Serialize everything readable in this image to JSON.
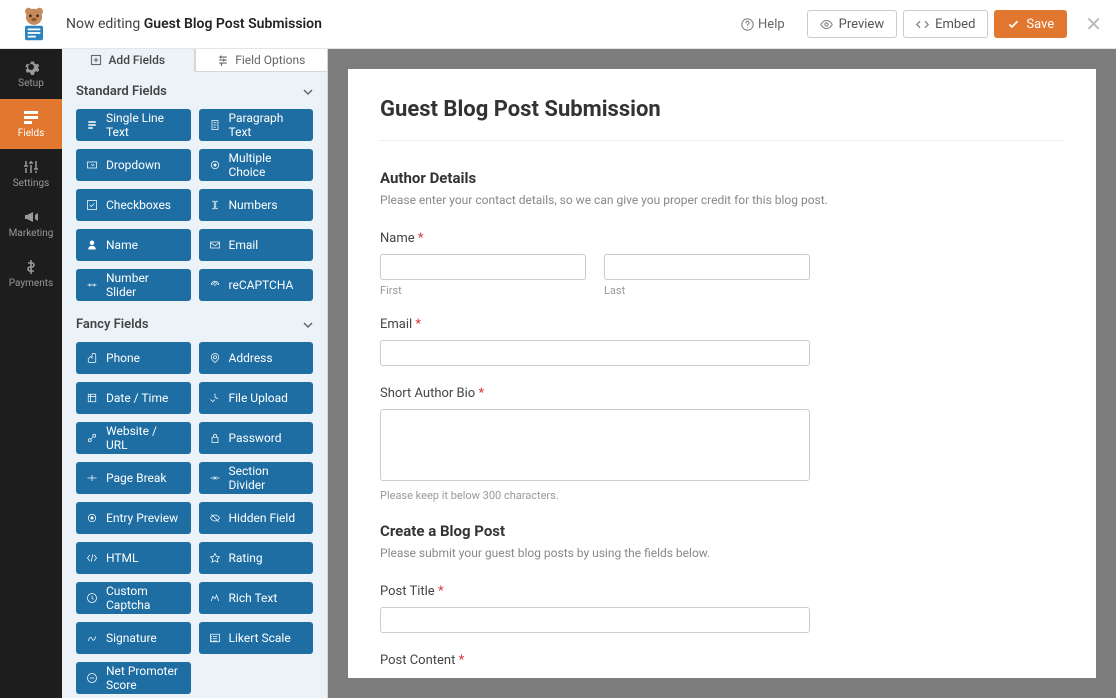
{
  "header": {
    "now_editing_prefix": "Now editing",
    "form_name": "Guest Blog Post Submission",
    "help": "Help",
    "preview": "Preview",
    "embed": "Embed",
    "save": "Save"
  },
  "leftnav": [
    {
      "label": "Setup"
    },
    {
      "label": "Fields"
    },
    {
      "label": "Settings"
    },
    {
      "label": "Marketing"
    },
    {
      "label": "Payments"
    }
  ],
  "tabs": {
    "add": "Add Fields",
    "options": "Field Options"
  },
  "groups": {
    "standard": {
      "title": "Standard Fields",
      "items": [
        "Single Line Text",
        "Paragraph Text",
        "Dropdown",
        "Multiple Choice",
        "Checkboxes",
        "Numbers",
        "Name",
        "Email",
        "Number Slider",
        "reCAPTCHA"
      ]
    },
    "fancy": {
      "title": "Fancy Fields",
      "items": [
        "Phone",
        "Address",
        "Date / Time",
        "File Upload",
        "Website / URL",
        "Password",
        "Page Break",
        "Section Divider",
        "Entry Preview",
        "Hidden Field",
        "HTML",
        "Rating",
        "Custom Captcha",
        "Rich Text",
        "Signature",
        "Likert Scale",
        "Net Promoter Score"
      ]
    }
  },
  "form": {
    "title": "Guest Blog Post Submission",
    "s1_title": "Author Details",
    "s1_desc": "Please enter your contact details, so we can give you proper credit for this blog post.",
    "name_label": "Name",
    "first": "First",
    "last": "Last",
    "email_label": "Email",
    "bio_label": "Short Author Bio",
    "bio_hint": "Please keep it below 300 characters.",
    "s2_title": "Create a Blog Post",
    "s2_desc": "Please submit your guest blog posts by using the fields below.",
    "post_title": "Post Title",
    "post_content": "Post Content"
  }
}
